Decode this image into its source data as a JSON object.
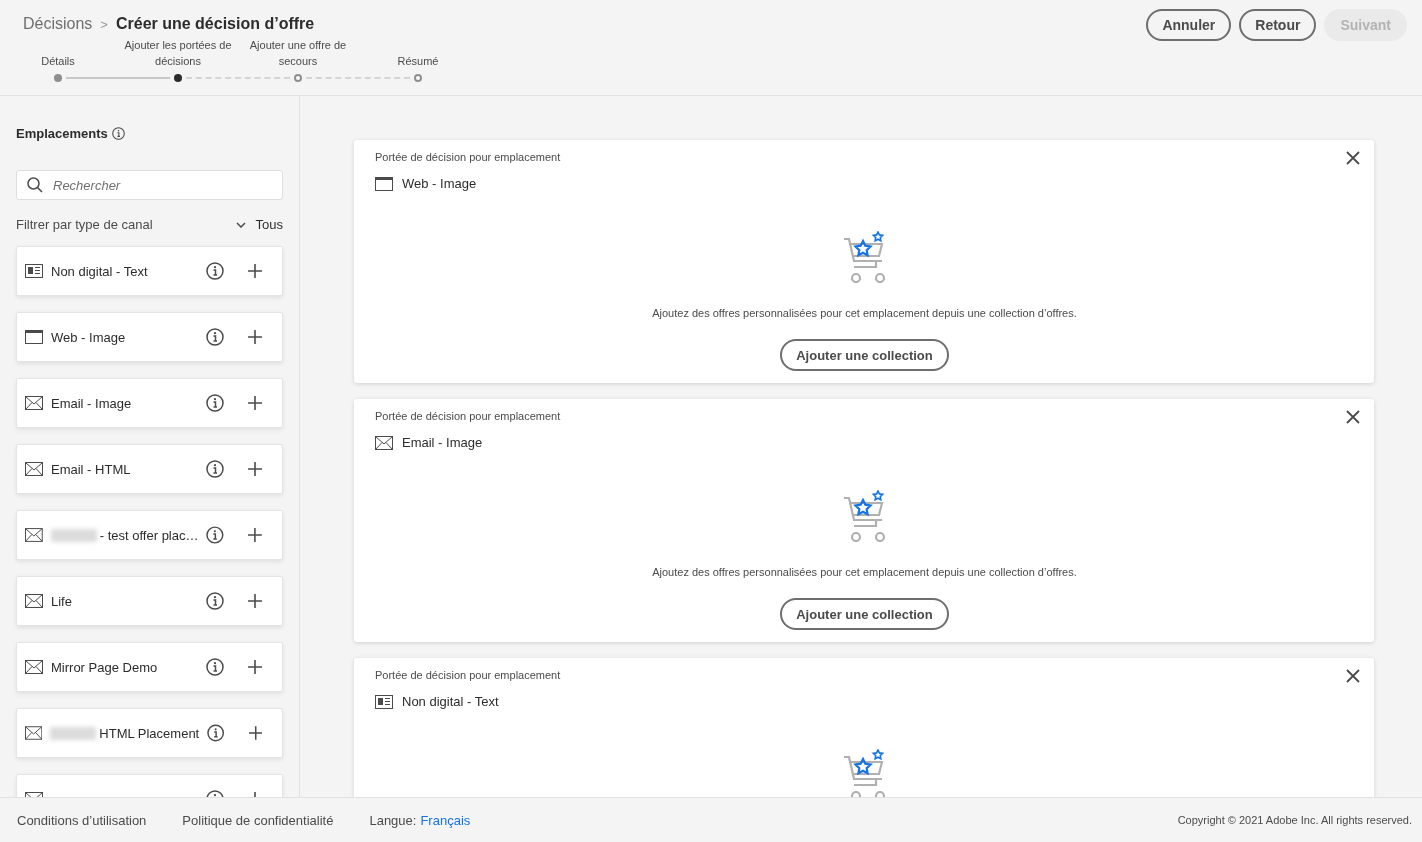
{
  "breadcrumb": {
    "parent": "Décisions",
    "separator": ">",
    "current": "Créer une décision d’offre"
  },
  "steps": [
    {
      "label": "Détails",
      "done": true,
      "selected": false
    },
    {
      "label": "Ajouter les portées de décisions",
      "done": false,
      "selected": true
    },
    {
      "label": "Ajouter une offre de secours",
      "done": false,
      "selected": false
    },
    {
      "label": "Résumé",
      "done": false,
      "selected": false
    }
  ],
  "header_buttons": [
    {
      "label": "Annuler",
      "disabled": false
    },
    {
      "label": "Retour",
      "disabled": false
    },
    {
      "label": "Suivant",
      "disabled": true
    }
  ],
  "sidebar": {
    "title": "Emplacements",
    "search": {
      "placeholder": "Rechercher"
    },
    "filter": {
      "label": "Filtrer par type de canal",
      "value": "Tous"
    },
    "items": [
      {
        "kind": "non_digital",
        "name": "Non digital - Text",
        "redacted": false
      },
      {
        "kind": "web",
        "name": "Web - Image",
        "redacted": false
      },
      {
        "kind": "email",
        "name": "Email - Image",
        "redacted": false
      },
      {
        "kind": "email",
        "name": "Email - HTML",
        "redacted": false
      },
      {
        "kind": "email",
        "name": "- test offer plac…",
        "redacted": true
      },
      {
        "kind": "email",
        "name": "Life",
        "redacted": false
      },
      {
        "kind": "email",
        "name": "Mirror Page Demo",
        "redacted": false
      },
      {
        "kind": "email",
        "name": "HTML Placement",
        "redacted": true
      },
      {
        "kind": "email",
        "redacted": false
      }
    ]
  },
  "scopes": [
    {
      "caption": "Portée de décision pour emplacement",
      "kind": "web",
      "name": "Web - Image",
      "message": "Ajoutez des offres personnalisées pour cet emplacement depuis une collection d’offres.",
      "button": "Ajouter une collection"
    },
    {
      "caption": "Portée de décision pour emplacement",
      "kind": "email",
      "name": "Email - Image",
      "message": "Ajoutez des offres personnalisées pour cet emplacement depuis une collection d’offres.",
      "button": "Ajouter une collection"
    },
    {
      "caption": "Portée de décision pour emplacement",
      "kind": "non_digital",
      "name": "Non digital - Text"
    }
  ],
  "footer": {
    "links": [
      "Conditions d’utilisation",
      "Politique de confidentialité"
    ],
    "language_label": "Langue:",
    "language": "Français",
    "copyright": "Copyright ©  2021 Adobe Inc.  All rights reserved."
  }
}
